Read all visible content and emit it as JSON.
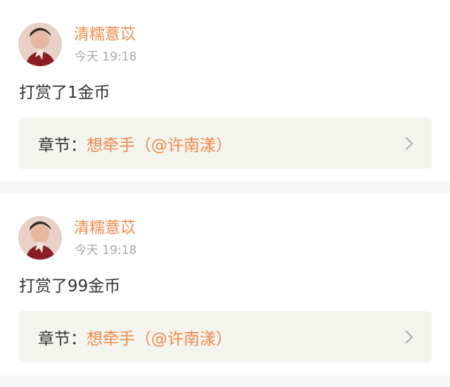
{
  "feed": {
    "items": [
      {
        "user_name": "清糯薏苡",
        "timestamp": "今天 19:18",
        "tip_text": "打赏了1金币",
        "chapter_prefix": "章节：",
        "chapter_title": "想牵手（@许南漾）",
        "icon": "chevron-right-icon"
      },
      {
        "user_name": "清糯薏苡",
        "timestamp": "今天 19:18",
        "tip_text": "打赏了99金币",
        "chapter_prefix": "章节：",
        "chapter_title": "想牵手（@许南漾）",
        "icon": "chevron-right-icon"
      }
    ]
  },
  "colors": {
    "accent": "#f08a4b",
    "text": "#333333",
    "muted": "#a8a8a8",
    "panel": "#f4f4ef",
    "background": "#f6f6f6"
  }
}
